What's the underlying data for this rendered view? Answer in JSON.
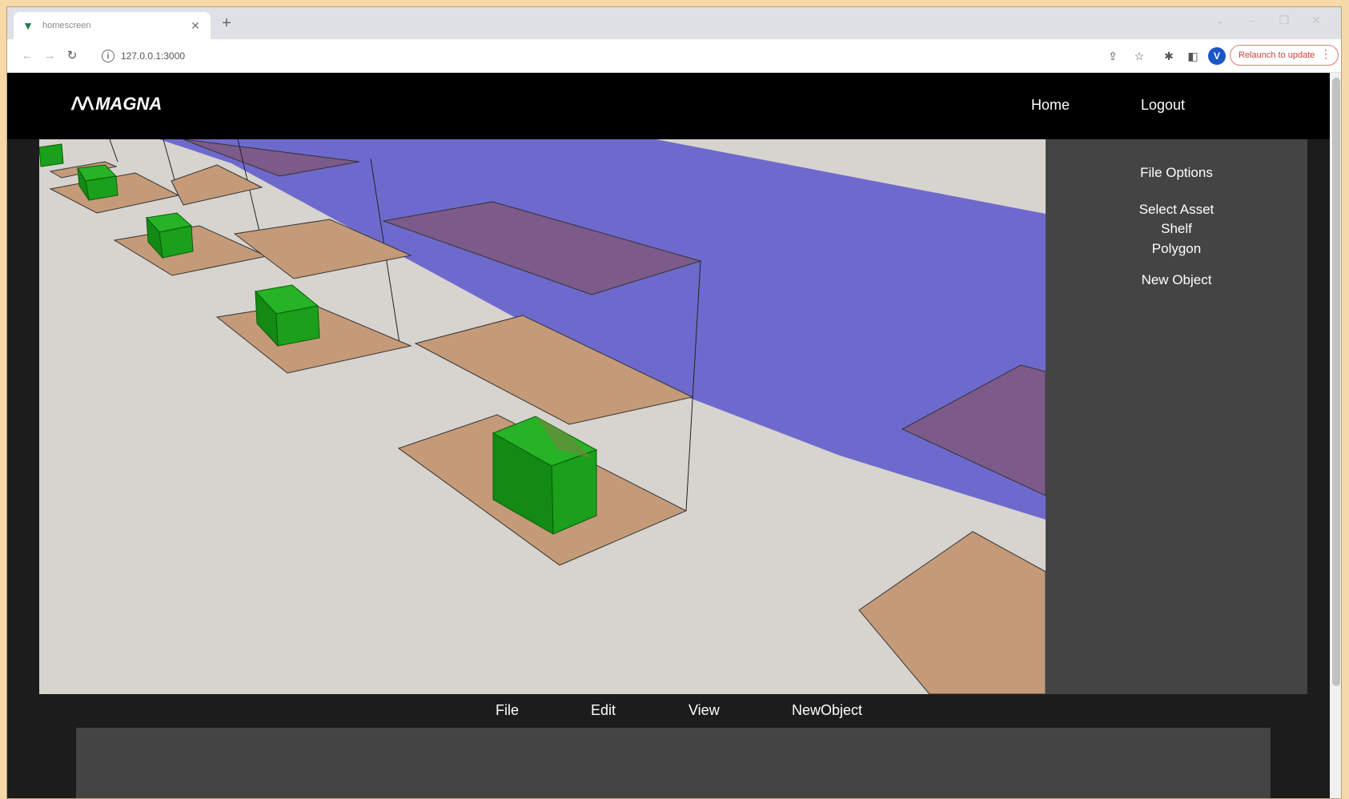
{
  "browser": {
    "tab_title": "homescreen",
    "tab_favicon": "vue-logo-icon",
    "url": "127.0.0.1:3000",
    "avatar_letter": "V",
    "relaunch_label": "Relaunch to update"
  },
  "header": {
    "logo_text": "MAGNA",
    "nav": {
      "home": "Home",
      "logout": "Logout"
    }
  },
  "sidebar": {
    "file_options": "File Options",
    "select_asset": "Select Asset",
    "shelf": "Shelf",
    "polygon": "Polygon",
    "new_object": "New Object"
  },
  "menubar": {
    "file": "File",
    "edit": "Edit",
    "view": "View",
    "new_object": "NewObject"
  },
  "colors": {
    "floor": "#d7d4cf",
    "aisle": "#6e6acd",
    "shelf_top": "#7c5a8a",
    "pallet": "#c49a78",
    "box": "#1aa01a",
    "panel": "#444444",
    "header": "#000000"
  }
}
